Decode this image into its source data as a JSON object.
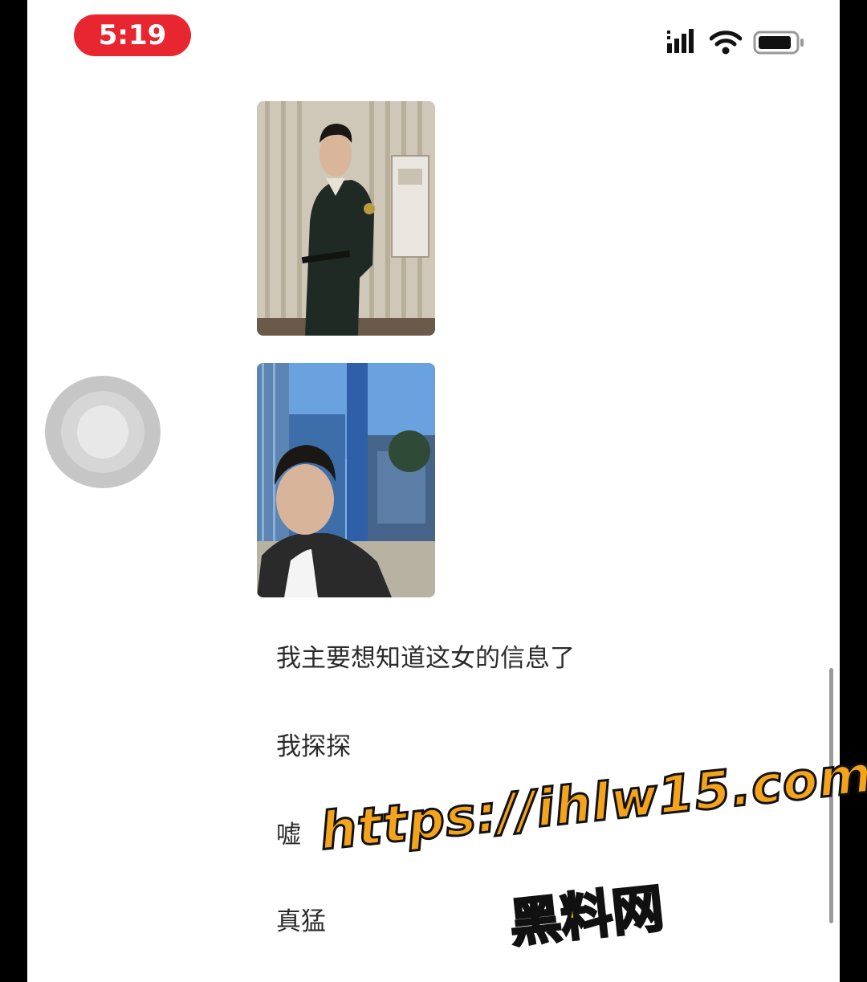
{
  "status_bar": {
    "time": "5:19",
    "signal_icon": "cellular-signal-icon",
    "wifi_icon": "wifi-icon",
    "battery_icon": "battery-icon"
  },
  "chat": {
    "images": [
      {
        "name": "photo-soldier-uniform"
      },
      {
        "name": "photo-man-selfie-building"
      }
    ],
    "messages": [
      {
        "text": "我主要想知道这女的信息了"
      },
      {
        "text": "我探探"
      },
      {
        "text": "嘘"
      },
      {
        "text": "真猛"
      }
    ]
  },
  "assistive_touch": {
    "icon": "assistive-touch-icon"
  },
  "watermark": {
    "url": "https://ihlw15.com",
    "name": "黑料网"
  },
  "colors": {
    "time_pill": "#e8262f",
    "watermark": "#f3a31c",
    "text": "#2b2b2b"
  }
}
